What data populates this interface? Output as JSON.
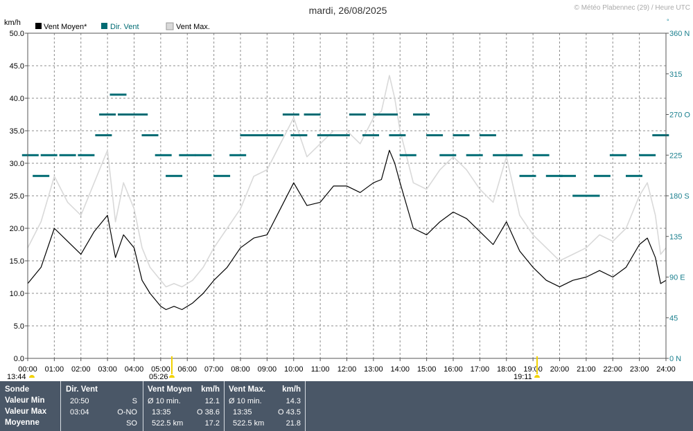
{
  "title": "mardi, 26/08/2025",
  "copyright": "© Météo Plabennec (29) / Heure UTC",
  "legend": {
    "wind_avg": "Vent Moyen*",
    "wind_dir": "Dir. Vent",
    "wind_max": "Vent Max."
  },
  "colors": {
    "wind_avg": "#000000",
    "wind_dir": "#006b73",
    "wind_max": "#d9d9d9",
    "grid": "#8c8c8c",
    "footer_bg": "#4a5767",
    "sun_marker": "#f2d200"
  },
  "markers": {
    "left_time": "13:44",
    "sunrise": "05:26",
    "sunset": "19:11",
    "right_symbol": "°"
  },
  "chart_data": {
    "type": "line",
    "x_unit": "hour of day (UTC)",
    "xlim": [
      0,
      24
    ],
    "x_ticks": [
      "00:00",
      "01:00",
      "02:00",
      "03:00",
      "04:00",
      "05:00",
      "06:00",
      "07:00",
      "08:00",
      "09:00",
      "10:00",
      "11:00",
      "12:00",
      "13:00",
      "14:00",
      "15:00",
      "16:00",
      "17:00",
      "18:00",
      "19:00",
      "20:00",
      "21:00",
      "22:00",
      "23:00",
      "24:00"
    ],
    "ylabel": "km/h",
    "ylim": [
      0,
      50
    ],
    "y_ticks": [
      "0.0",
      "5.0",
      "10.0",
      "15.0",
      "20.0",
      "25.0",
      "30.0",
      "35.0",
      "40.0",
      "45.0",
      "50.0"
    ],
    "y2lim": [
      0,
      360
    ],
    "y2_ticks": [
      "0 N",
      "45",
      "90 E",
      "135",
      "180 S",
      "225",
      "270 O",
      "315",
      "360 N"
    ],
    "grid": true,
    "legend_position": "top-left",
    "series": [
      {
        "name": "Vent Moyen*",
        "style": "line",
        "x": [
          0,
          0.5,
          1,
          1.5,
          2,
          2.5,
          3,
          3.3,
          3.6,
          4,
          4.3,
          4.6,
          5,
          5.2,
          5.5,
          5.8,
          6.2,
          6.6,
          7,
          7.5,
          8,
          8.5,
          9,
          9.5,
          10,
          10.5,
          11,
          11.5,
          12,
          12.5,
          13,
          13.3,
          13.6,
          13.8,
          14,
          14.5,
          15,
          15.5,
          16,
          16.5,
          17,
          17.5,
          18,
          18.5,
          19,
          19.5,
          20,
          20.5,
          21,
          21.5,
          22,
          22.5,
          23,
          23.3,
          23.6,
          23.8,
          24
        ],
        "values": [
          11.5,
          14,
          20,
          18,
          16,
          19.5,
          22,
          15.5,
          19,
          17,
          12,
          10,
          8,
          7.5,
          8,
          7.5,
          8.5,
          10,
          12,
          14,
          17,
          18.5,
          19,
          23,
          27,
          23.5,
          24,
          26.5,
          26.5,
          25.5,
          27,
          27.5,
          32,
          30,
          27,
          20,
          19,
          21,
          22.5,
          21.5,
          19.5,
          17.5,
          21,
          16.5,
          14,
          12,
          11,
          12,
          12.5,
          13.5,
          12.5,
          14,
          17.5,
          18.5,
          15.5,
          11.5,
          12
        ]
      },
      {
        "name": "Vent Max.",
        "style": "line",
        "x": [
          0,
          0.5,
          1,
          1.5,
          2,
          2.5,
          3,
          3.3,
          3.6,
          4,
          4.3,
          4.6,
          5,
          5.2,
          5.5,
          5.8,
          6.2,
          6.6,
          7,
          7.5,
          8,
          8.5,
          9,
          9.5,
          10,
          10.5,
          11,
          11.5,
          12,
          12.5,
          13,
          13.3,
          13.6,
          13.8,
          14,
          14.5,
          15,
          15.5,
          16,
          16.5,
          17,
          17.5,
          18,
          18.5,
          19,
          19.5,
          20,
          20.5,
          21,
          21.5,
          22,
          22.5,
          23,
          23.3,
          23.6,
          23.8,
          24
        ],
        "values": [
          17,
          21,
          28,
          24,
          22,
          27,
          32,
          21,
          27,
          23,
          17,
          14,
          12,
          11,
          11.5,
          11,
          12,
          14,
          17,
          20,
          23,
          28,
          29,
          33,
          37,
          31,
          33,
          35,
          35,
          33,
          37,
          38,
          43.5,
          40,
          35,
          27,
          26,
          29,
          31,
          29,
          26,
          24,
          31,
          22,
          19,
          17,
          15,
          16,
          17,
          19,
          18,
          20,
          25,
          27,
          22,
          16,
          17
        ]
      },
      {
        "name": "Dir. Vent",
        "style": "scatter",
        "axis": "y2",
        "x": [
          0.1,
          0.5,
          0.8,
          1.5,
          2.2,
          2.85,
          3.0,
          3.4,
          3.7,
          4.2,
          4.6,
          5.1,
          5.5,
          6.0,
          6.6,
          7.3,
          7.9,
          8.3,
          8.8,
          9.3,
          9.9,
          10.2,
          10.7,
          11.2,
          11.8,
          12.4,
          12.9,
          13.3,
          13.6,
          13.9,
          14.3,
          14.8,
          15.3,
          15.8,
          16.3,
          16.8,
          17.3,
          17.8,
          18.3,
          18.8,
          19.3,
          19.8,
          20.3,
          20.8,
          21.2,
          21.6,
          22.2,
          22.8,
          23.3,
          23.8
        ],
        "values": [
          225,
          202,
          225,
          225,
          225,
          247,
          270,
          292,
          270,
          270,
          247,
          225,
          202,
          225,
          225,
          202,
          225,
          247,
          247,
          247,
          270,
          247,
          270,
          247,
          247,
          270,
          247,
          270,
          270,
          247,
          225,
          270,
          247,
          225,
          247,
          225,
          247,
          225,
          225,
          202,
          225,
          202,
          202,
          180,
          180,
          202,
          225,
          202,
          225,
          247
        ]
      }
    ]
  },
  "table": {
    "row_labels": [
      "Sonde",
      "Valeur Min",
      "Valeur Max",
      "Moyenne"
    ],
    "dir": {
      "header": "Dir. Vent",
      "min_time": "20:50",
      "min_val": "S",
      "max_time": "03:04",
      "max_val": "O-NO",
      "mean_val": "SO"
    },
    "avg": {
      "header": "Vent Moyen",
      "unit": "km/h",
      "min_label": "Ø 10 min.",
      "min_val": "12.1",
      "max_time": "13:35",
      "max_val": "O 38.6",
      "dist": "522.5 km",
      "mean_val": "17.2"
    },
    "max": {
      "header": "Vent Max.",
      "unit": "km/h",
      "min_label": "Ø 10 min.",
      "min_val": "14.3",
      "max_time": "13:35",
      "max_val": "O 43.5",
      "dist": "522.5 km",
      "mean_val": "21.8"
    }
  }
}
